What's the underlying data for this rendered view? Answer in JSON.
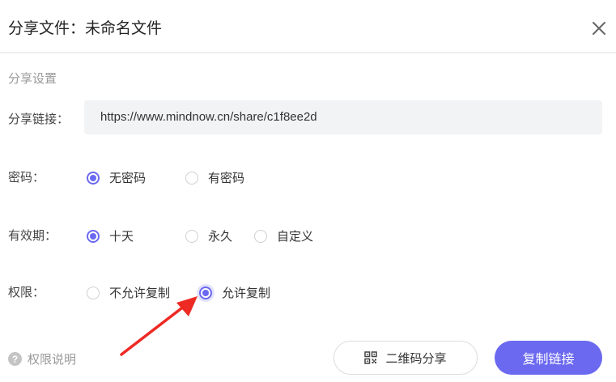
{
  "dialog": {
    "title": "分享文件：未命名文件",
    "close_icon": "close-icon"
  },
  "settings": {
    "section_title": "分享设置",
    "link": {
      "label": "分享链接：",
      "value": "https://www.mindnow.cn/share/c1f8ee2d"
    },
    "password": {
      "label": "密码：",
      "options": [
        "无密码",
        "有密码"
      ],
      "selected": "无密码"
    },
    "validity": {
      "label": "有效期：",
      "options": [
        "十天",
        "永久",
        "自定义"
      ],
      "selected": "十天"
    },
    "permission": {
      "label": "权限：",
      "options": [
        "不允许复制",
        "允许复制"
      ],
      "selected": "允许复制"
    }
  },
  "footer": {
    "help_label": "权限说明",
    "qr_button_label": "二维码分享",
    "copy_button_label": "复制链接"
  },
  "colors": {
    "accent": "#6b69f0",
    "annotation_arrow": "#ee2a24"
  }
}
